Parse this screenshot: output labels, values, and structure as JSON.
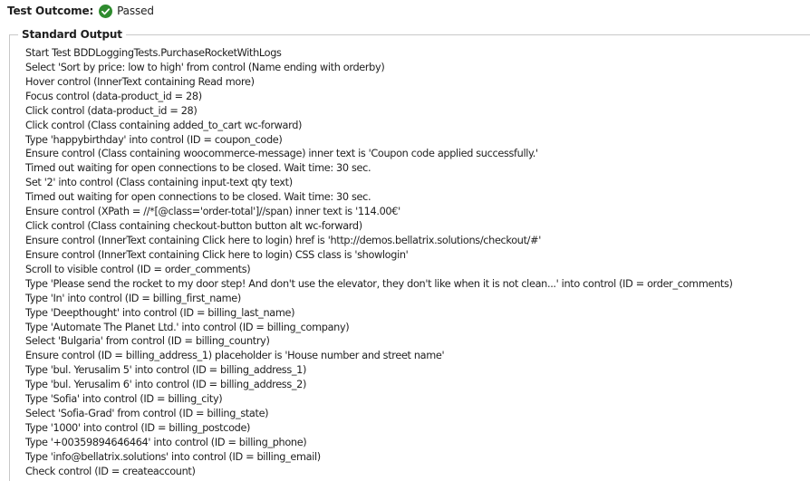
{
  "outcome": {
    "label": "Test Outcome:",
    "value": "Passed",
    "status_icon": "check-circle-icon",
    "status_color": "#2e8b2e"
  },
  "standard_output": {
    "title": "Standard Output",
    "lines": [
      "Start Test BDDLoggingTests.PurchaseRocketWithLogs",
      "Select 'Sort by price: low to high' from control (Name ending with orderby)",
      "Hover control (InnerText containing Read more)",
      "Focus control (data-product_id = 28)",
      "Click control (data-product_id = 28)",
      "Click control (Class containing added_to_cart wc-forward)",
      "Type 'happybirthday' into control (ID = coupon_code)",
      "Ensure control (Class containing woocommerce-message) inner text is 'Coupon code applied successfully.'",
      "Timed out waiting for open connections to be closed. Wait time: 30 sec.",
      "Set '2' into control (Class containing input-text qty text)",
      "Timed out waiting for open connections to be closed. Wait time: 30 sec.",
      "Ensure control (XPath = //*[@class='order-total']//span) inner text is '114.00€'",
      "Click control (Class containing checkout-button button alt wc-forward)",
      "Ensure control (InnerText containing Click here to login) href is 'http://demos.bellatrix.solutions/checkout/#'",
      "Ensure control (InnerText containing Click here to login) CSS class is 'showlogin'",
      "Scroll to visible control (ID = order_comments)",
      "Type 'Please send the rocket to my door step! And don't use the elevator, they don't like when it is not clean...' into control (ID = order_comments)",
      "Type 'In' into control (ID = billing_first_name)",
      "Type 'Deepthought' into control (ID = billing_last_name)",
      "Type 'Automate The Planet Ltd.' into control (ID = billing_company)",
      "Select 'Bulgaria' from control (ID = billing_country)",
      "Ensure control (ID = billing_address_1) placeholder is 'House number and street name'",
      "Type 'bul. Yerusalim 5' into control (ID = billing_address_1)",
      "Type 'bul. Yerusalim 6' into control (ID = billing_address_2)",
      "Type 'Sofia' into control (ID = billing_city)",
      "Select 'Sofia-Grad' from control (ID = billing_state)",
      "Type '1000' into control (ID = billing_postcode)",
      "Type '+00359894646464' into control (ID = billing_phone)",
      "Type 'info@bellatrix.solutions' into control (ID = billing_email)",
      "Check control (ID = createaccount)"
    ]
  }
}
